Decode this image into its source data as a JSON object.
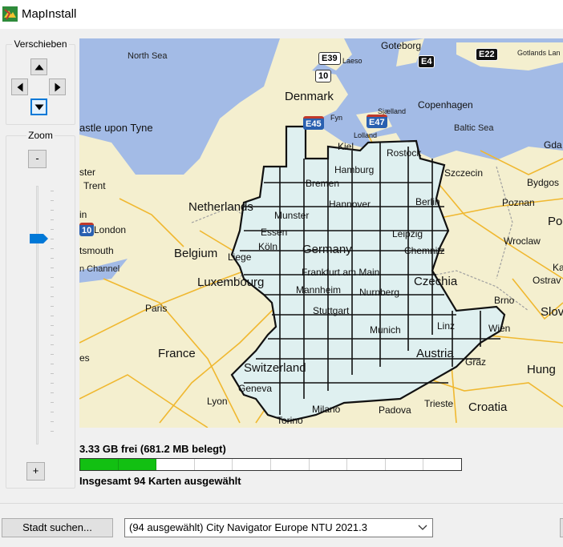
{
  "window": {
    "title": "MapInstall",
    "icon": "mapinstall-app-icon"
  },
  "pan": {
    "legend": "Verschieben",
    "icons": [
      "arrow-up-icon",
      "arrow-left-icon",
      "arrow-right-icon",
      "arrow-down-icon"
    ]
  },
  "zoom": {
    "legend": "Zoom",
    "minus_label": "-",
    "plus_label": "+",
    "level": 0.23
  },
  "map": {
    "countries": [
      "Denmark",
      "Netherlands",
      "Belgium",
      "Luxembourg",
      "Germany",
      "Czechia",
      "France",
      "Switzerland",
      "Austria",
      "Croatia",
      "Hung",
      "Slov",
      "Po"
    ],
    "cities": [
      "Goteborg",
      "Copenhagen",
      "Laeso",
      "Fyn",
      "Sjælland",
      "Lolland",
      "Kiel",
      "Rostock",
      "Hamburg",
      "Bremen",
      "Hannover",
      "Berlin",
      "Szczecin",
      "Bydgos",
      "Poznan",
      "Munster",
      "Essen",
      "Köln",
      "Liege",
      "Leipzig",
      "Chemnitz",
      "Frankfurt am Main",
      "Mannheim",
      "Nurnberg",
      "Stuttgart",
      "Munich",
      "Linz",
      "Wien",
      "Graz",
      "Wroclaw",
      "Brno",
      "Ostrav",
      "Ka",
      "Gda",
      "Paris",
      "London",
      "Trent",
      "ster",
      "in",
      "tsmouth",
      "astle upon Tyne",
      "Geneva",
      "Lyon",
      "Torino",
      "Milano",
      "Padova",
      "Trieste",
      "es"
    ],
    "seas": [
      "North Sea",
      "Baltic Sea",
      "Gotlands Lan",
      "n Channel"
    ],
    "shields": [
      "E39",
      "10",
      "E4",
      "E22",
      "E45",
      "E47",
      "10"
    ]
  },
  "storage": {
    "free_text": "3.33 GB frei (681.2 MB belegt)",
    "used_fraction": 0.167,
    "segments": 10
  },
  "selection": {
    "total_text": "Insgesamt 94 Karten ausgewählt"
  },
  "footer": {
    "city_search_label": "Stadt suchen...",
    "product_select": "(94 ausgewählt) City Navigator Europe NTU 2021.3"
  },
  "colors": {
    "map_land": "#f4efcf",
    "map_water": "#a3bbe6",
    "selected_area": "#dff0f0",
    "progress_fill": "#12c012",
    "accent": "#0078d7"
  }
}
